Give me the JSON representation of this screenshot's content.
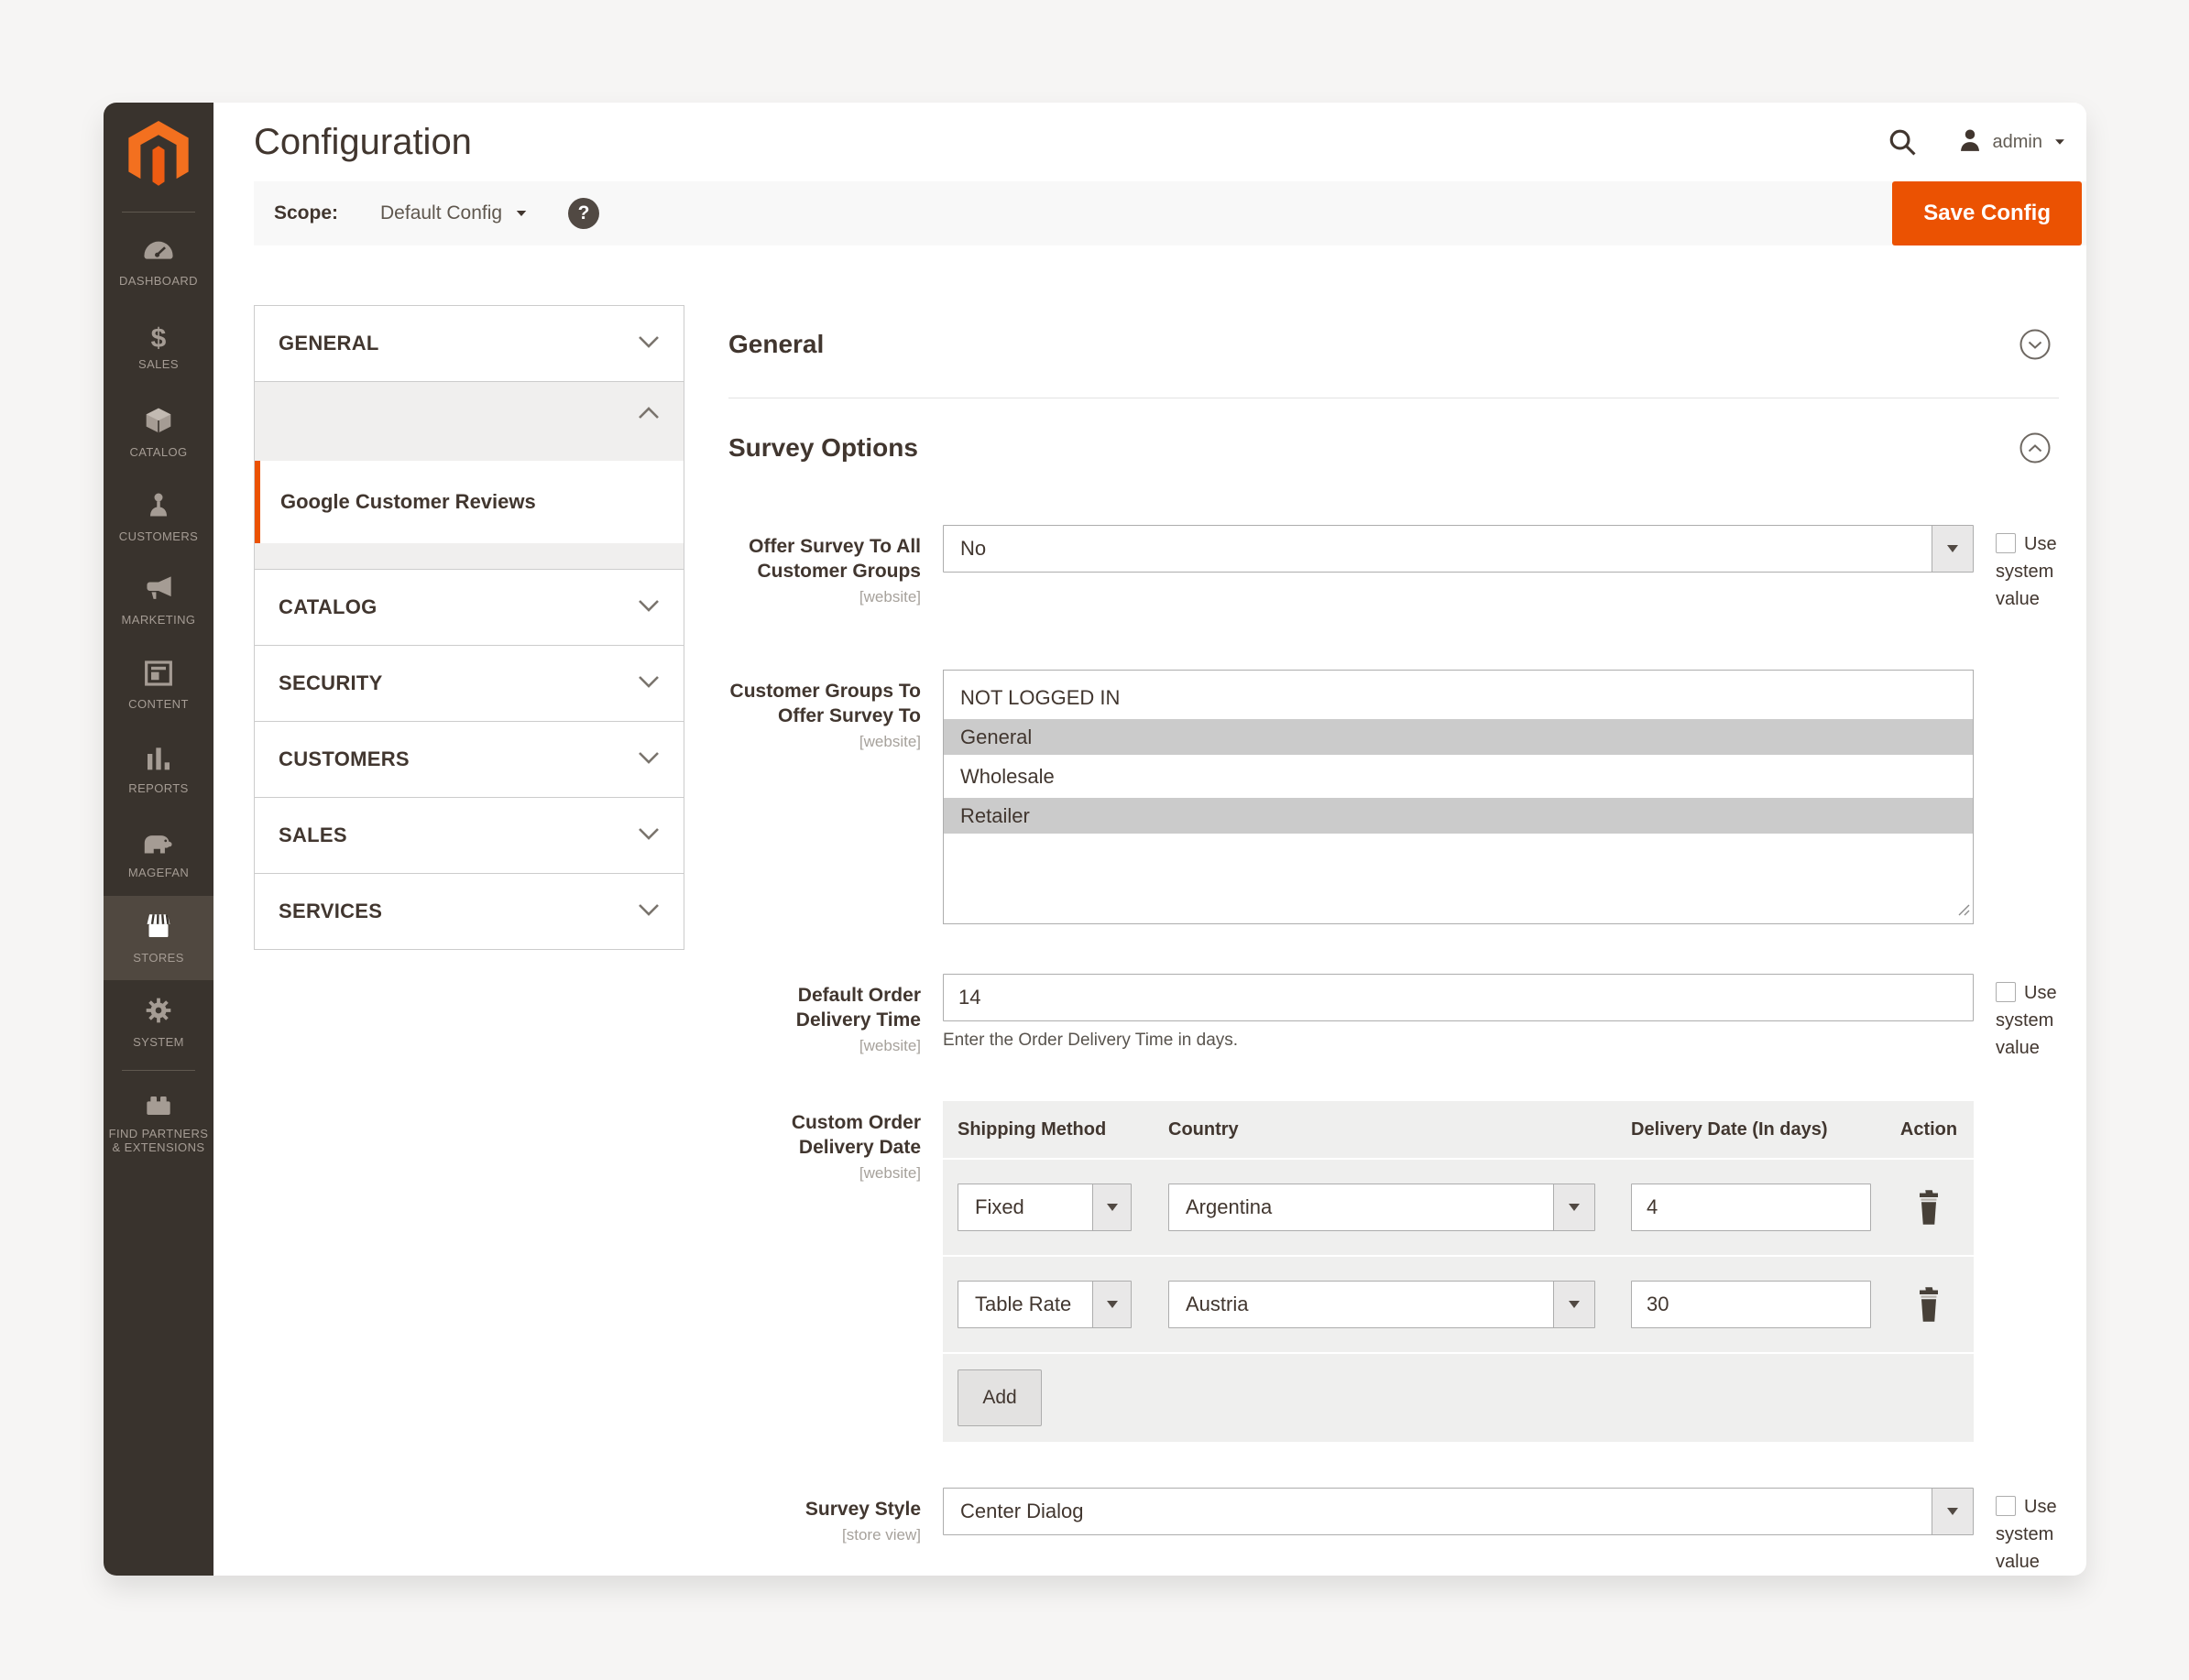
{
  "app": {
    "accent_color": "#eb5202",
    "sidebar_color": "#39332d"
  },
  "sidebar": {
    "items": [
      {
        "label": "DASHBOARD",
        "icon": "dashboard-icon"
      },
      {
        "label": "SALES",
        "icon": "sales-icon"
      },
      {
        "label": "CATALOG",
        "icon": "catalog-icon"
      },
      {
        "label": "CUSTOMERS",
        "icon": "customers-icon"
      },
      {
        "label": "MARKETING",
        "icon": "marketing-icon"
      },
      {
        "label": "CONTENT",
        "icon": "content-icon"
      },
      {
        "label": "REPORTS",
        "icon": "reports-icon"
      },
      {
        "label": "MAGEFAN",
        "icon": "magefan-icon"
      },
      {
        "label": "STORES",
        "icon": "stores-icon",
        "active": true
      },
      {
        "label": "SYSTEM",
        "icon": "system-icon"
      },
      {
        "label": "FIND PARTNERS & EXTENSIONS",
        "icon": "extensions-icon"
      }
    ]
  },
  "header": {
    "title": "Configuration",
    "user_label": "admin"
  },
  "toolbar": {
    "scope_label": "Scope:",
    "scope_value": "Default Config",
    "save_label": "Save Config"
  },
  "config_nav": {
    "sections": [
      {
        "label": "GENERAL"
      },
      {
        "label": "CATALOG"
      },
      {
        "label": "SECURITY"
      },
      {
        "label": "CUSTOMERS"
      },
      {
        "label": "SALES"
      },
      {
        "label": "SERVICES"
      }
    ],
    "active_item": "Google Customer Reviews"
  },
  "main": {
    "section_title": "General",
    "subsection_title": "Survey Options",
    "use_system_value": "Use system value",
    "fields": {
      "offer_survey": {
        "label": "Offer Survey To All Customer Groups",
        "scope": "[website]",
        "value": "No"
      },
      "customer_groups": {
        "label": "Customer Groups To Offer Survey To",
        "scope": "[website]",
        "options": [
          {
            "label": "NOT LOGGED IN",
            "selected": false
          },
          {
            "label": "General",
            "selected": true
          },
          {
            "label": "Wholesale",
            "selected": false
          },
          {
            "label": "Retailer",
            "selected": true
          }
        ]
      },
      "default_delivery": {
        "label": "Default Order Delivery Time",
        "scope": "[website]",
        "value": "14",
        "note": "Enter the Order Delivery Time in days."
      },
      "custom_delivery": {
        "label": "Custom Order Delivery Date",
        "scope": "[website]",
        "columns": [
          "Shipping Method",
          "Country",
          "Delivery Date (In days)",
          "Action"
        ],
        "rows": [
          {
            "shipping_method": "Fixed",
            "country": "Argentina",
            "days": "4"
          },
          {
            "shipping_method": "Table Rate",
            "country": "Austria",
            "days": "30"
          }
        ],
        "add_label": "Add"
      },
      "survey_style": {
        "label": "Survey Style",
        "scope": "[store view]",
        "value": "Center Dialog"
      }
    }
  }
}
